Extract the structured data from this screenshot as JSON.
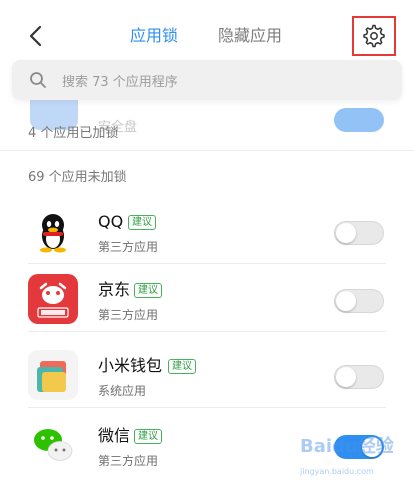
{
  "header": {
    "tabs": [
      {
        "label": "应用锁",
        "active": true
      },
      {
        "label": "隐藏应用",
        "active": false
      }
    ]
  },
  "search": {
    "placeholder": "搜索 73 个应用程序"
  },
  "locked_section": {
    "count_label": "4 个应用已加锁",
    "faded_app_name": "安全盘"
  },
  "unlocked_section": {
    "title": "69 个应用未加锁"
  },
  "apps": [
    {
      "name": "QQ",
      "badge": "建议",
      "type": "第三方应用",
      "locked": false,
      "icon": "qq-icon"
    },
    {
      "name": "京东",
      "badge": "建议",
      "type": "第三方应用",
      "locked": false,
      "icon": "jd-icon"
    },
    {
      "name": "小米钱包",
      "badge": "建议",
      "type": "系统应用",
      "locked": false,
      "icon": "mi-wallet-icon"
    },
    {
      "name": "微信",
      "badge": "建议",
      "type": "第三方应用",
      "locked": true,
      "icon": "wechat-icon"
    }
  ],
  "watermark": {
    "text": "Baidu经验",
    "sub": "jingyan.baidu.com"
  },
  "colors": {
    "accent": "#2f8ff0",
    "badge_green": "#2e9b43",
    "highlight_red": "#e53935",
    "jd_red": "#e4393c"
  }
}
